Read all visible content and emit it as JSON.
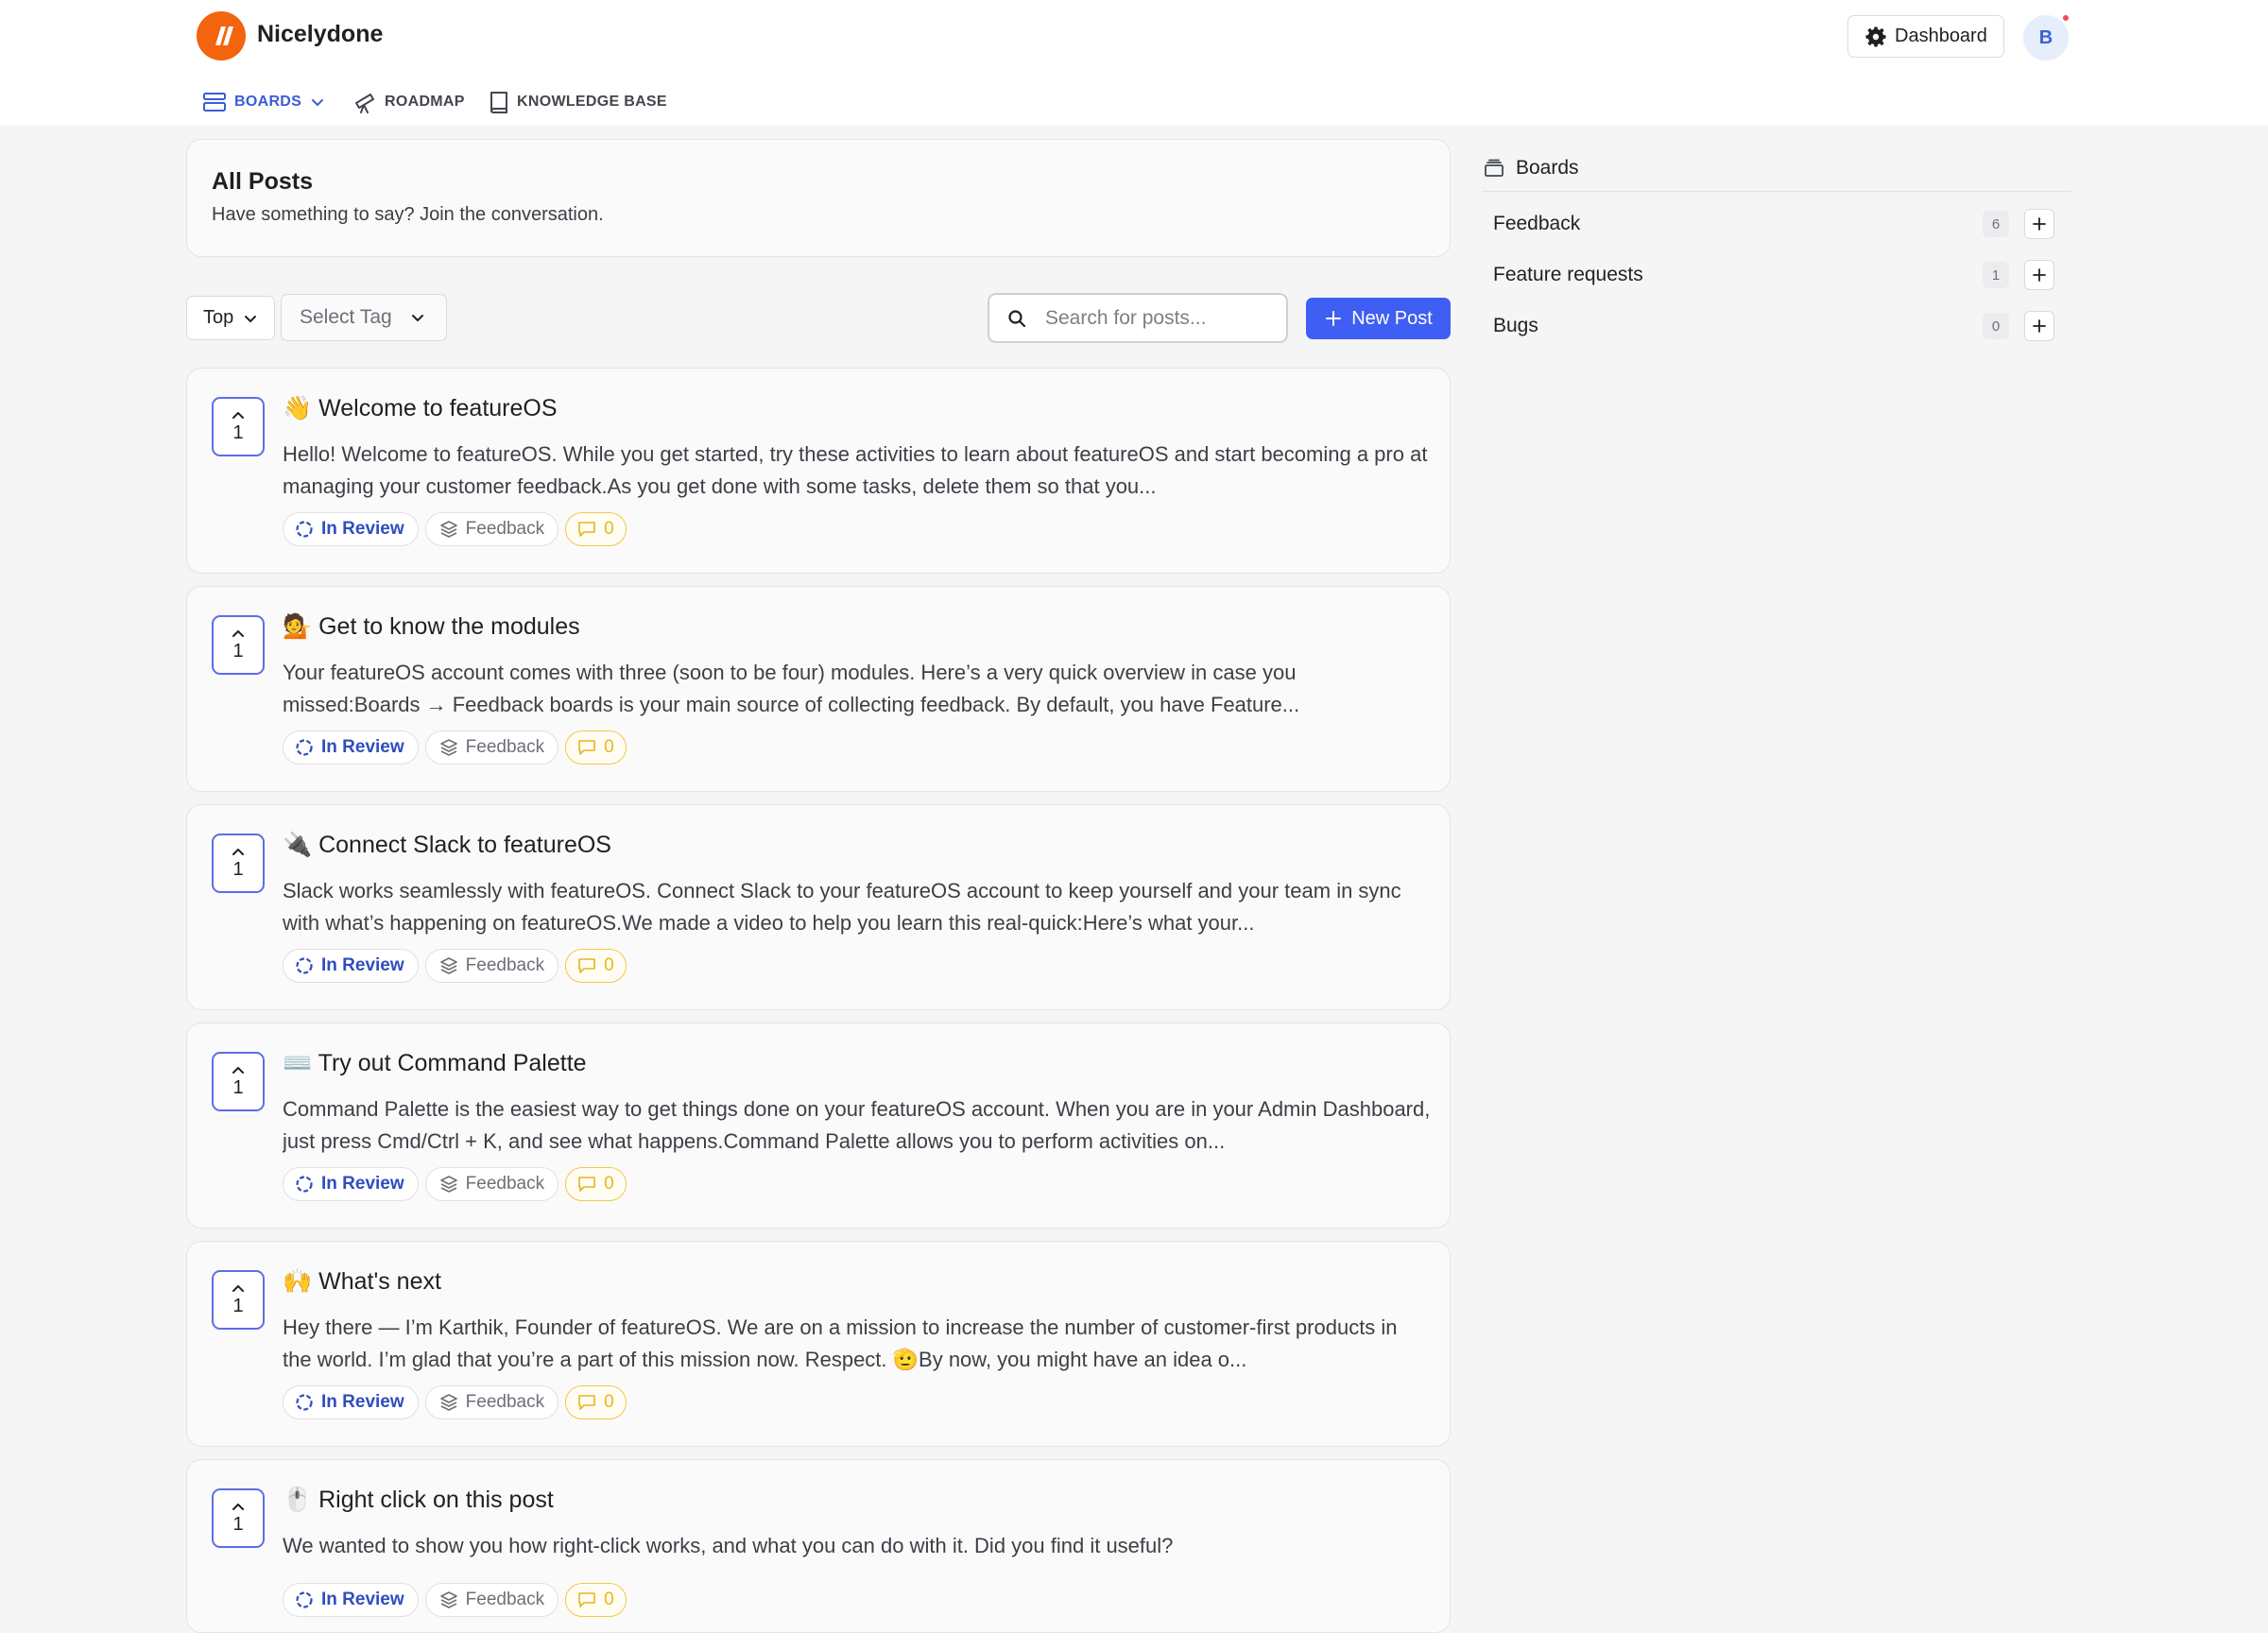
{
  "app": {
    "brand": "Nicelydone",
    "dashboard_label": "Dashboard",
    "avatar_initial": "B",
    "accent_color": "#3f5ef3",
    "logo_color": "#f4630d"
  },
  "nav": {
    "boards": "BOARDS",
    "roadmap": "ROADMAP",
    "knowledge_base": "KNOWLEDGE BASE"
  },
  "header": {
    "title": "All Posts",
    "subtitle": "Have something to say? Join the conversation."
  },
  "filters": {
    "sort": "Top",
    "tag_placeholder": "Select Tag",
    "search_placeholder": "Search for posts...",
    "new_post": "New Post"
  },
  "posts": [
    {
      "emoji": "👋",
      "title": "Welcome to featureOS",
      "body": "Hello! Welcome to featureOS. While you get started, try these activities to learn about featureOS and start becoming a pro at managing your customer feedback.As you get done with some tasks, delete them so that you...",
      "votes": "1",
      "status": "In Review",
      "board": "Feedback",
      "comments": "0"
    },
    {
      "emoji": "💁",
      "title": "Get to know the modules",
      "body": "Your featureOS account comes with three (soon to be four) modules. Here’s a very quick overview in case you missed:Boards → Feedback boards is your main source of collecting feedback. By default, you have Feature...",
      "votes": "1",
      "status": "In Review",
      "board": "Feedback",
      "comments": "0"
    },
    {
      "emoji": "🔌",
      "title": "Connect Slack to featureOS",
      "body": "Slack works seamlessly with featureOS. Connect Slack to your featureOS account to keep yourself and your team in sync with what’s happening on featureOS.We made a video to help you learn this real-quick:Here’s what your...",
      "votes": "1",
      "status": "In Review",
      "board": "Feedback",
      "comments": "0"
    },
    {
      "emoji": "⌨️",
      "title": "Try out Command Palette",
      "body": "Command Palette is the easiest way to get things done on your featureOS account. When you are in your Admin Dashboard, just press Cmd/Ctrl + K, and see what happens.Command Palette allows you to perform activities on...",
      "votes": "1",
      "status": "In Review",
      "board": "Feedback",
      "comments": "0"
    },
    {
      "emoji": "🙌",
      "title": "What's next",
      "body": "Hey there — I’m Karthik, Founder of featureOS. We are on a mission to increase the number of customer-first products in the world. I’m glad that you’re a part of this mission now. Respect. 🫡By now, you might have an idea o...",
      "votes": "1",
      "status": "In Review",
      "board": "Feedback",
      "comments": "0"
    },
    {
      "emoji": "🖱️",
      "title": "Right click on this post",
      "body": "We wanted to show you how right-click works, and what you can do with it. Did you find it useful?",
      "votes": "1",
      "status": "In Review",
      "board": "Feedback",
      "comments": "0"
    }
  ],
  "sidebar": {
    "title": "Boards",
    "boards": [
      {
        "name": "Feedback",
        "count": "6"
      },
      {
        "name": "Feature requests",
        "count": "1"
      },
      {
        "name": "Bugs",
        "count": "0"
      }
    ]
  }
}
